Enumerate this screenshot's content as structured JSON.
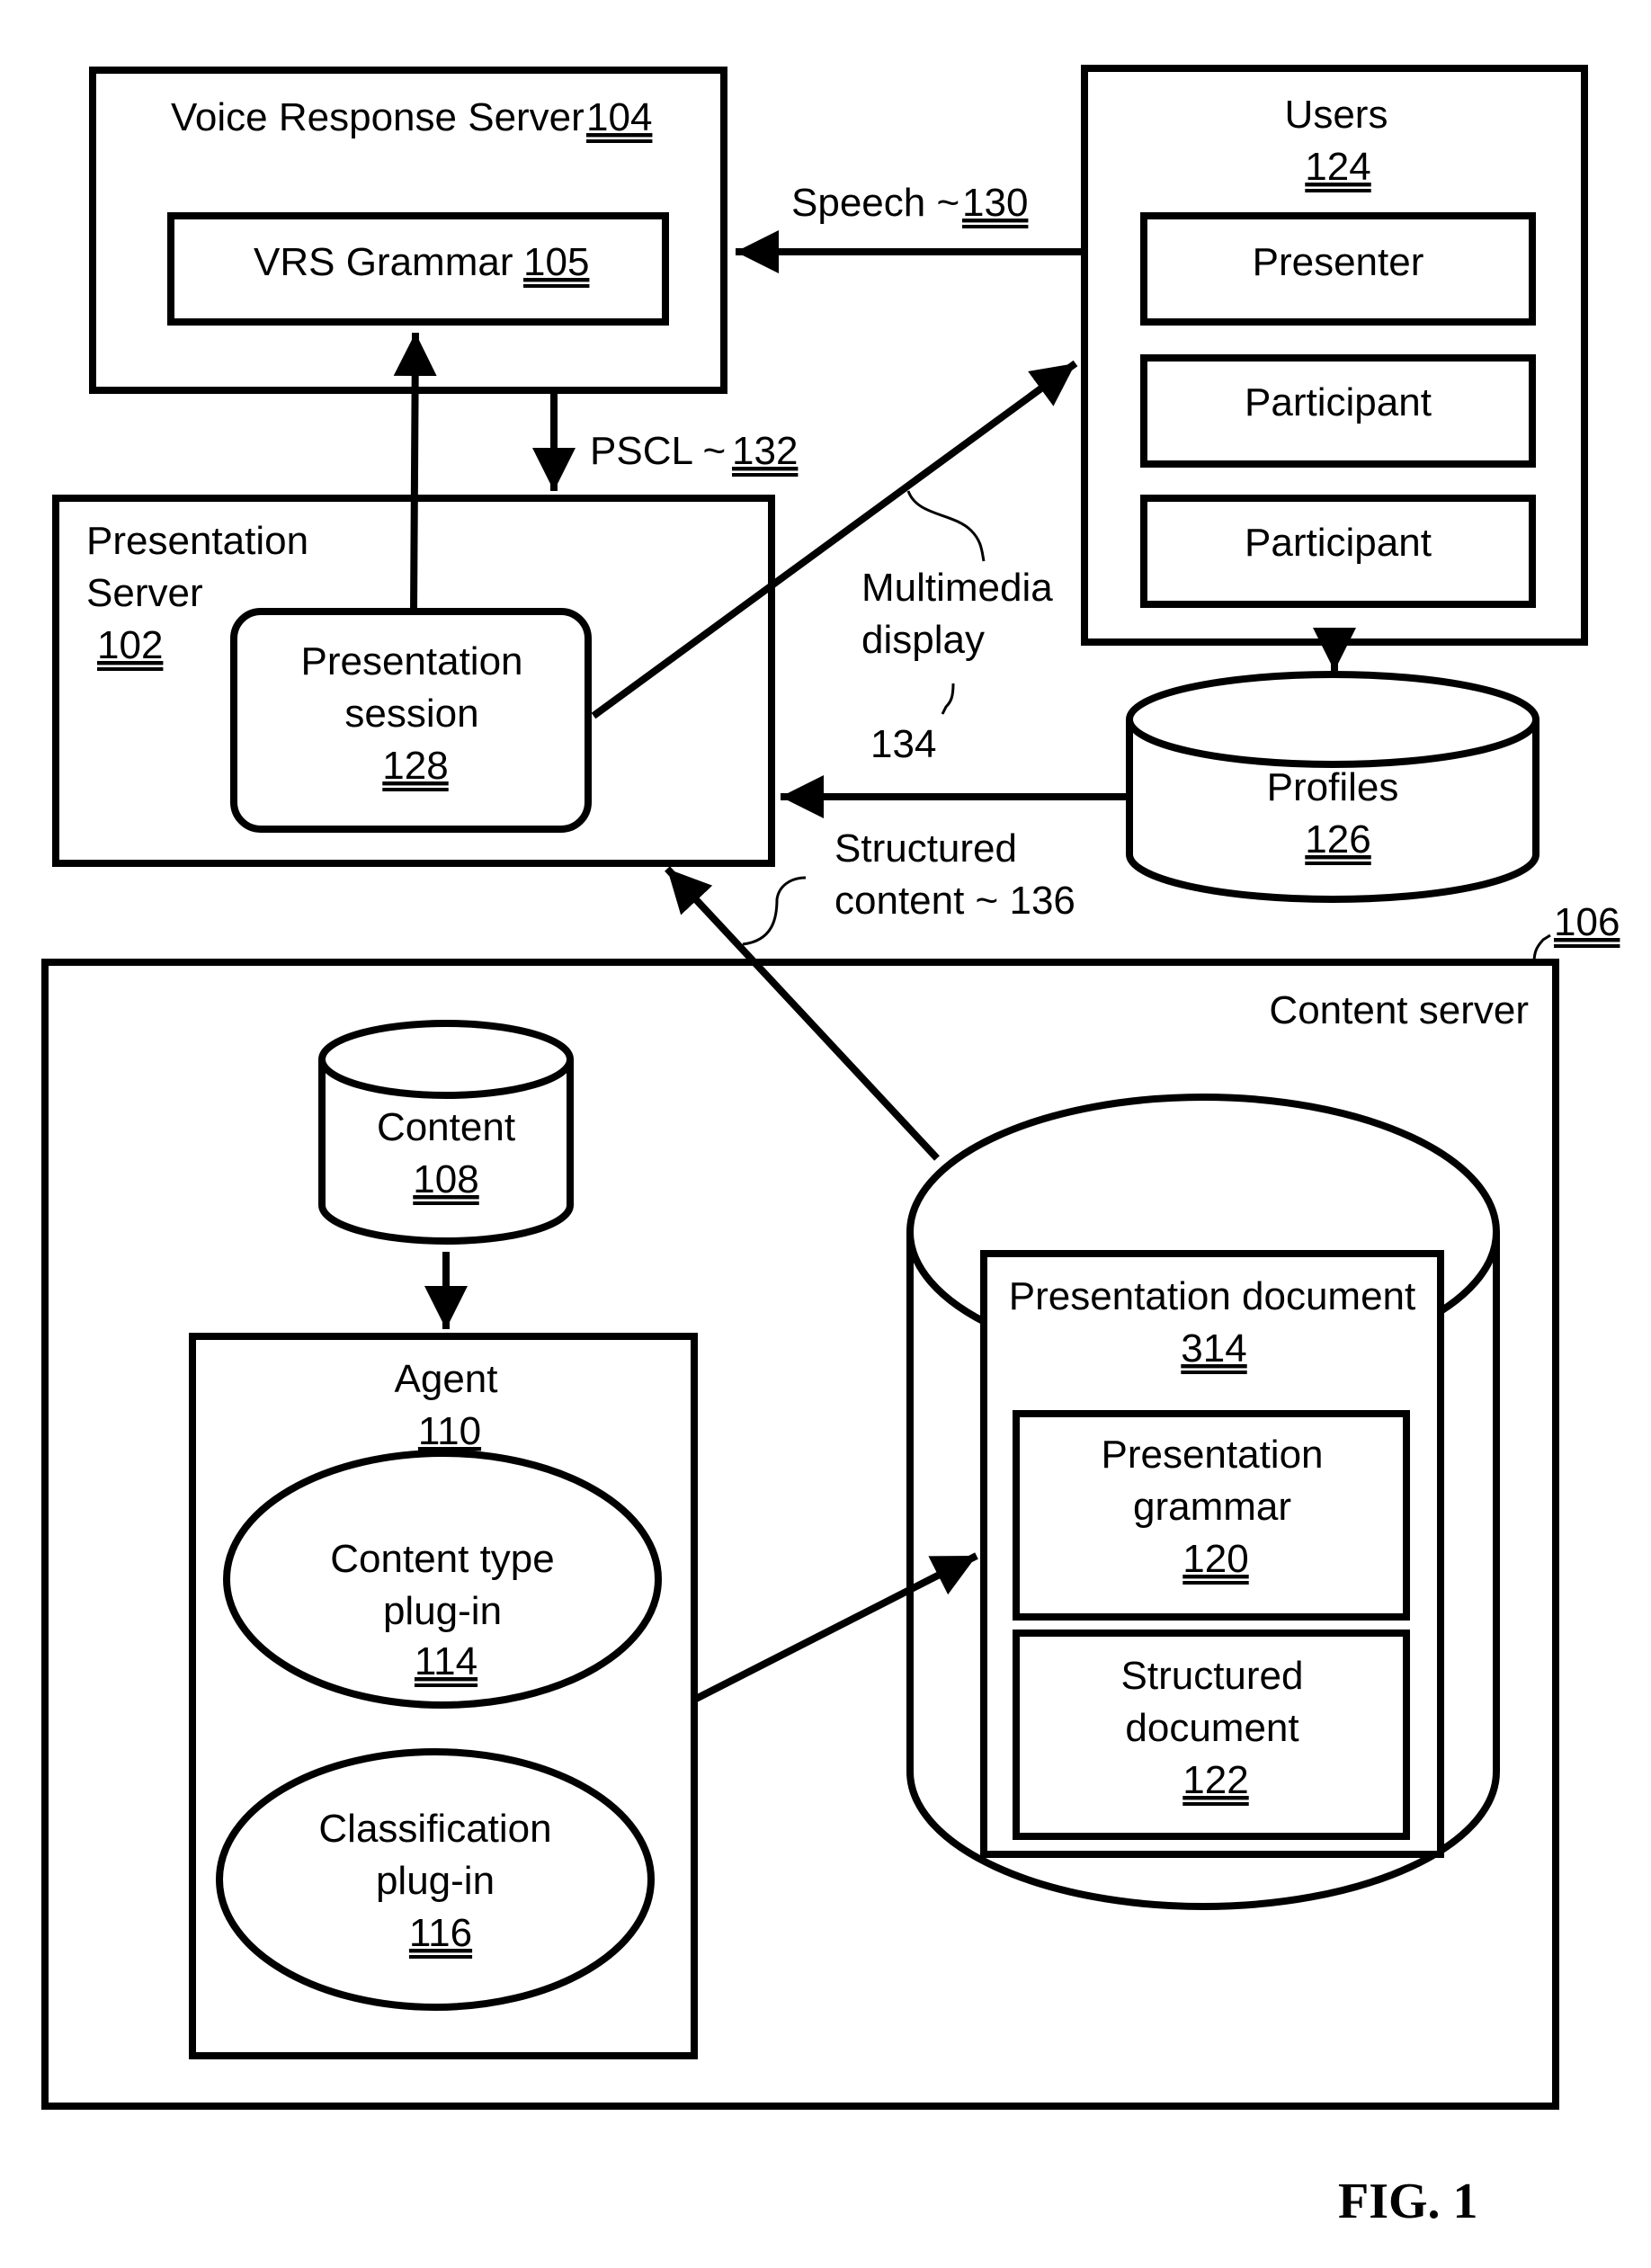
{
  "figure": {
    "caption": "FIG. 1",
    "colors": {
      "ink": "#000000",
      "paper": "#ffffff"
    }
  },
  "nodes": {
    "voice_response_server": {
      "label": "Voice Response Server",
      "ref": "104"
    },
    "vrs_grammar": {
      "label": "VRS Grammar",
      "ref": "105"
    },
    "users": {
      "label": "Users",
      "ref": "124"
    },
    "presenter": {
      "label": "Presenter"
    },
    "participant_1": {
      "label": "Participant"
    },
    "participant_2": {
      "label": "Participant"
    },
    "presentation_server": {
      "label_line1": "Presentation",
      "label_line2": "Server",
      "ref": "102"
    },
    "presentation_session": {
      "label_line1": "Presentation",
      "label_line2": "session",
      "ref": "128"
    },
    "profiles": {
      "label": "Profiles",
      "ref": "126"
    },
    "content_server": {
      "label": "Content server",
      "ref": "106"
    },
    "content": {
      "label": "Content",
      "ref": "108"
    },
    "agent": {
      "label": "Agent",
      "ref": "110"
    },
    "content_type_plugin": {
      "label_line1": "Content type",
      "label_line2": "plug-in",
      "ref": "114"
    },
    "classification_plugin": {
      "label_line1": "Classification",
      "label_line2": "plug-in",
      "ref": "116"
    },
    "presentation_document": {
      "label": "Presentation document",
      "ref": "314"
    },
    "presentation_grammar": {
      "label_line1": "Presentation",
      "label_line2": "grammar",
      "ref": "120"
    },
    "structured_document": {
      "label_line1": "Structured",
      "label_line2": "document",
      "ref": "122"
    }
  },
  "edges": {
    "speech": {
      "label": "Speech ~",
      "ref": "130"
    },
    "pscl": {
      "label": "PSCL ~",
      "ref": "132"
    },
    "multimedia_display": {
      "label_line1": "Multimedia",
      "label_line2": "display",
      "ref": "134"
    },
    "structured_content": {
      "label_line1": "Structured",
      "label_line2": "content  ~ 136"
    }
  }
}
